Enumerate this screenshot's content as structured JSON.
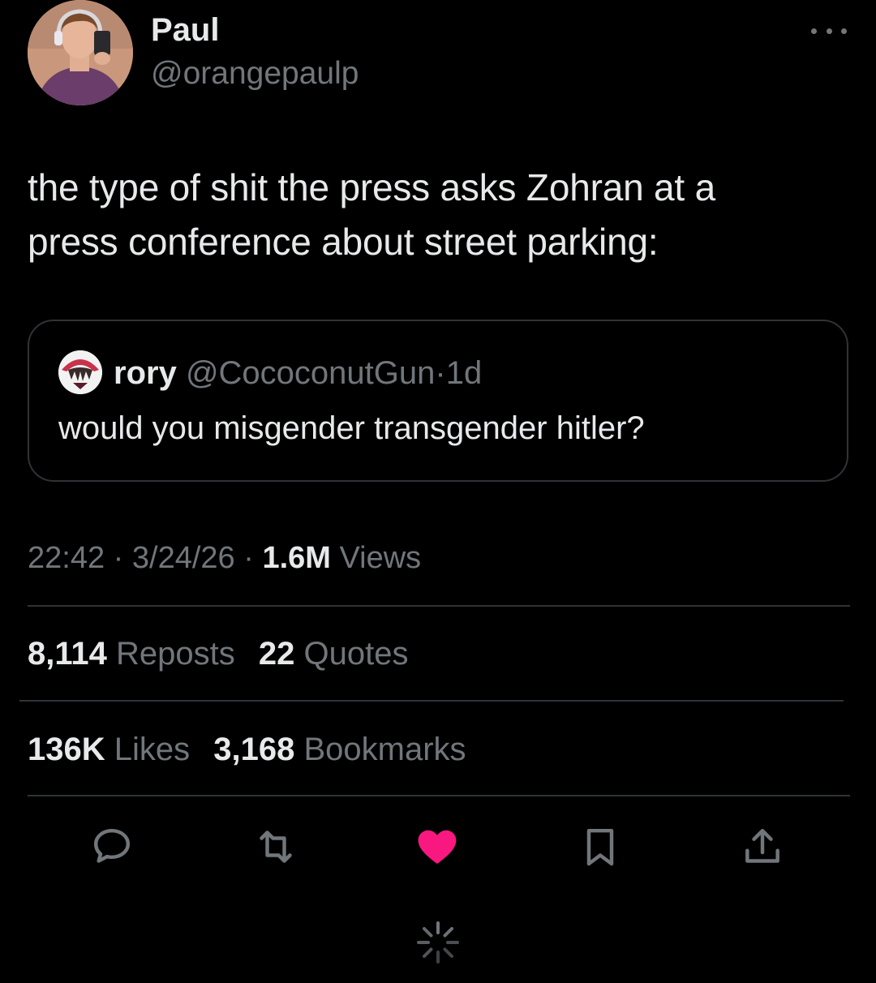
{
  "tweet": {
    "author": {
      "display_name": "Paul",
      "handle": "@orangepaulp"
    },
    "text_line1": "the type of shit the press asks Zohran at a",
    "text_line2": "press conference about street parking:",
    "quoted": {
      "display_name": "rory",
      "handle": "@CococonutGun",
      "separator": "·",
      "time": "1d",
      "text": "would you misgender transgender hitler?"
    },
    "meta": {
      "time": "22:42",
      "separator": "·",
      "date": "3/24/26",
      "views_count": "1.6M",
      "views_label": "Views"
    },
    "stats": {
      "reposts_count": "8,114",
      "reposts_label": "Reposts",
      "quotes_count": "22",
      "quotes_label": "Quotes",
      "likes_count": "136K",
      "likes_label": "Likes",
      "bookmarks_count": "3,168",
      "bookmarks_label": "Bookmarks"
    },
    "actions": {
      "liked": true,
      "icons": [
        "reply-icon",
        "repost-icon",
        "like-icon",
        "bookmark-icon",
        "share-icon"
      ]
    }
  },
  "colors": {
    "background": "#000000",
    "primary_text": "#e7e9ea",
    "secondary_text": "#71767b",
    "divider": "#2f3336",
    "like_active": "#f91880"
  }
}
